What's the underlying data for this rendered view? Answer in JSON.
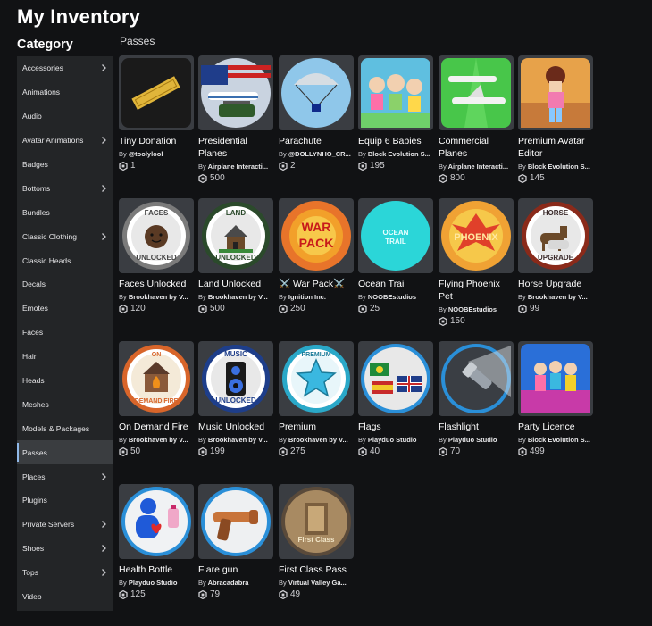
{
  "header": {
    "title": "My Inventory"
  },
  "sidebar": {
    "title": "Category",
    "items": [
      {
        "label": "Accessories",
        "has_chevron": true
      },
      {
        "label": "Animations",
        "has_chevron": false
      },
      {
        "label": "Audio",
        "has_chevron": false
      },
      {
        "label": "Avatar Animations",
        "has_chevron": true
      },
      {
        "label": "Badges",
        "has_chevron": false
      },
      {
        "label": "Bottoms",
        "has_chevron": true
      },
      {
        "label": "Bundles",
        "has_chevron": false
      },
      {
        "label": "Classic Clothing",
        "has_chevron": true
      },
      {
        "label": "Classic Heads",
        "has_chevron": false
      },
      {
        "label": "Decals",
        "has_chevron": false
      },
      {
        "label": "Emotes",
        "has_chevron": false
      },
      {
        "label": "Faces",
        "has_chevron": false
      },
      {
        "label": "Hair",
        "has_chevron": false
      },
      {
        "label": "Heads",
        "has_chevron": false
      },
      {
        "label": "Meshes",
        "has_chevron": false
      },
      {
        "label": "Models & Packages",
        "has_chevron": false
      },
      {
        "label": "Passes",
        "has_chevron": false,
        "active": true
      },
      {
        "label": "Places",
        "has_chevron": true
      },
      {
        "label": "Plugins",
        "has_chevron": false
      },
      {
        "label": "Private Servers",
        "has_chevron": true
      },
      {
        "label": "Shoes",
        "has_chevron": true
      },
      {
        "label": "Tops",
        "has_chevron": true
      },
      {
        "label": "Video",
        "has_chevron": false
      }
    ]
  },
  "main": {
    "section_label": "Passes",
    "by_prefix": "By",
    "items": [
      {
        "name": "Tiny Donation",
        "creator": "@toolylool",
        "price": "1",
        "icon": "ticket-thumbnail"
      },
      {
        "name": "Presidential Planes",
        "creator": "Airplane Interacti...",
        "price": "500",
        "icon": "presidential-planes-thumbnail"
      },
      {
        "name": "Parachute",
        "creator": "@DOLLYNHO_CR...",
        "price": "2",
        "icon": "parachute-thumbnail"
      },
      {
        "name": "Equip 6 Babies",
        "creator": "Block Evolution S...",
        "price": "195",
        "icon": "babies-thumbnail"
      },
      {
        "name": "Commercial Planes",
        "creator": "Airplane Interacti...",
        "price": "800",
        "icon": "commercial-planes-thumbnail"
      },
      {
        "name": "Premium Avatar Editor",
        "creator": "Block Evolution S...",
        "price": "145",
        "icon": "avatar-editor-thumbnail"
      },
      {
        "name": "Faces Unlocked",
        "creator": "Brookhaven by V...",
        "price": "120",
        "icon": "faces-unlocked-thumbnail",
        "badge_top": "FACES",
        "badge_bottom": "UNLOCKED"
      },
      {
        "name": "Land Unlocked",
        "creator": "Brookhaven by V...",
        "price": "500",
        "icon": "land-unlocked-thumbnail",
        "badge_top": "LAND",
        "badge_bottom": "UNLOCKED"
      },
      {
        "name": "⚔️ War Pack⚔️",
        "creator": "Ignition Inc.",
        "price": "250",
        "icon": "war-pack-thumbnail",
        "badge_top": "WAR",
        "badge_bottom": "PACK"
      },
      {
        "name": "Ocean Trail",
        "creator": "NOOBEstudios",
        "price": "25",
        "icon": "ocean-trail-thumbnail",
        "badge_top": "OCEAN",
        "badge_bottom": "TRAIL"
      },
      {
        "name": "Flying Phoenix Pet",
        "creator": "NOOBEstudios",
        "price": "150",
        "icon": "phoenix-thumbnail",
        "badge_top": "PHOENIX"
      },
      {
        "name": "Horse Upgrade",
        "creator": "Brookhaven by V...",
        "price": "99",
        "icon": "horse-upgrade-thumbnail",
        "badge_top": "HORSE",
        "badge_bottom": "UPGRADE"
      },
      {
        "name": "On Demand Fire",
        "creator": "Brookhaven by V...",
        "price": "50",
        "icon": "on-demand-fire-thumbnail",
        "badge_top": "ON",
        "badge_bottom": "DEMAND FIRE"
      },
      {
        "name": "Music Unlocked",
        "creator": "Brookhaven by V...",
        "price": "199",
        "icon": "music-unlocked-thumbnail",
        "badge_top": "MUSIC",
        "badge_bottom": "UNLOCKED"
      },
      {
        "name": "Premium",
        "creator": "Brookhaven by V...",
        "price": "275",
        "icon": "premium-star-thumbnail",
        "badge_top": "PREMIUM"
      },
      {
        "name": "Flags",
        "creator": "Playduo Studio",
        "price": "40",
        "icon": "flags-thumbnail"
      },
      {
        "name": "Flashlight",
        "creator": "Playduo Studio",
        "price": "70",
        "icon": "flashlight-thumbnail"
      },
      {
        "name": "Party Licence",
        "creator": "Block Evolution S...",
        "price": "499",
        "icon": "party-licence-thumbnail"
      },
      {
        "name": "Health Bottle",
        "creator": "Playduo Studio",
        "price": "125",
        "icon": "health-bottle-thumbnail"
      },
      {
        "name": "Flare gun",
        "creator": "Abracadabra",
        "price": "79",
        "icon": "flare-gun-thumbnail"
      },
      {
        "name": "First Class Pass",
        "creator": "Virtual Valley Ga...",
        "price": "49",
        "icon": "first-class-pass-thumbnail",
        "badge_bottom": "First Class"
      }
    ]
  },
  "colors": {
    "background": "#111214",
    "sidebar_bg": "#232527",
    "active_item_bg": "#3a3d40",
    "active_indicator": "#8fb8e8",
    "thumb_bg": "#3a3d42"
  }
}
